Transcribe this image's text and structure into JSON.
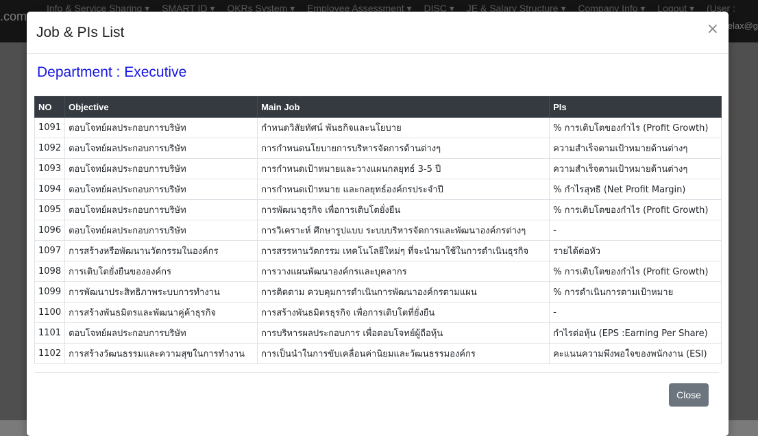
{
  "navbar": {
    "brand_fragment": ".com",
    "menu": [
      "Info & Service Sharing ▾",
      "SMART ID ▾",
      "OKRs System ▾",
      "Employee Assessment ▾",
      "DISC ▾",
      "JE & Salary Structure ▾",
      "Company Info ▾",
      "Logout ▾",
      "(User :"
    ],
    "user_fragment": "elax@g"
  },
  "modal": {
    "title": "Job & PIs List",
    "close_icon": "×",
    "department_label": "Department : ",
    "department_value": "Executive",
    "columns": [
      "NO",
      "Objective",
      "Main Job",
      "PIs"
    ],
    "rows": [
      [
        "1091",
        "ตอบโจทย์ผลประกอบการบริษัท",
        "กำหนดวิสัยทัศน์ พันธกิจและนโยบาย",
        "% การเติบโตของกำไร (Profit Growth)"
      ],
      [
        "1092",
        "ตอบโจทย์ผลประกอบการบริษัท",
        "การกำหนดนโยบายการบริหารจัดการด้านต่างๆ",
        "ความสำเร็จตามเป้าหมายด้านต่างๆ"
      ],
      [
        "1093",
        "ตอบโจทย์ผลประกอบการบริษัท",
        "การกำหนดเป้าหมายและวางแผนกลยุทธ์ 3-5 ปี",
        "ความสำเร็จตามเป้าหมายด้านต่างๆ"
      ],
      [
        "1094",
        "ตอบโจทย์ผลประกอบการบริษัท",
        "การกำหนดเป้าหมาย และกลยุทธ์องค์กรประจำปี",
        "% กำไรสุทธิ (Net Profit Margin)"
      ],
      [
        "1095",
        "ตอบโจทย์ผลประกอบการบริษัท",
        "การพัฒนาธุรกิจ เพื่อการเติบโตยั่งยืน",
        "% การเติบโตของกำไร (Profit Growth)"
      ],
      [
        "1096",
        "ตอบโจทย์ผลประกอบการบริษัท",
        "การวิเคราะห์ ศึกษารูปแบบ ระบบบริหารจัดการและพัฒนาองค์กรต่างๆ",
        "-"
      ],
      [
        "1097",
        "การสร้างหรือพัฒนานวัตกรรมในองค์กร",
        "การสรรหานวัตกรรม เทคโนโลยีใหม่ๆ ที่จะนำมาใช้ในการดำเนินธุรกิจ",
        "รายได้ต่อหัว"
      ],
      [
        "1098",
        "การเติบโตยั่งยืนขององค์กร",
        "การวางแผนพัฒนาองค์กรและบุคลากร",
        "% การเติบโตของกำไร (Profit Growth)"
      ],
      [
        "1099",
        "การพัฒนาประสิทธิภาพระบบการทำงาน",
        "การติดตาม ควบคุมการดำเนินการพัฒนาองค์กรตามแผน",
        "% การดำเนินการตามเป้าหมาย"
      ],
      [
        "1100",
        "การสร้างพันธมิตรและพัฒนาคู่ค้าธุรกิจ",
        "การสร้างพันธมิตรธุรกิจ เพื่อการเติบโตที่ยั่งยืน",
        "-"
      ],
      [
        "1101",
        "ตอบโจทย์ผลประกอบการบริษัท",
        "การบริหารผลประกอบการ เพื่อตอบโจทย์ผู้ถือหุ้น",
        "กำไรต่อหุ้น (EPS :Earning Per Share)"
      ],
      [
        "1102",
        "การสร้างวัฒนธรรมและความสุขในการทำงาน",
        "การเป็นนำในการขับเคลื่อนค่านิยมและวัฒนธรรมองค์กร",
        "คะแนนความพึงพอใจของพนักงาน (ESI)"
      ]
    ],
    "close_button_label": "Close"
  }
}
